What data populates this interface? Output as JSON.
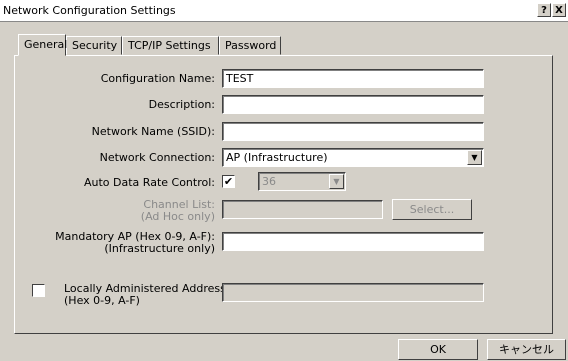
{
  "window": {
    "title": "Network Configuration Settings",
    "help_glyph": "?",
    "close_glyph": "X"
  },
  "tabs": [
    {
      "label": "General",
      "active": true
    },
    {
      "label": "Security",
      "active": false
    },
    {
      "label": "TCP/IP Settings",
      "active": false
    },
    {
      "label": "Password",
      "active": false
    }
  ],
  "form": {
    "configuration_name": {
      "label": "Configuration Name:",
      "value": "TEST"
    },
    "description": {
      "label": "Description:",
      "value": ""
    },
    "network_name": {
      "label": "Network Name (SSID):",
      "value": ""
    },
    "network_connection": {
      "label": "Network Connection:",
      "value": "AP (Infrastructure)"
    },
    "auto_data_rate": {
      "label": "Auto Data Rate Control:",
      "checked": true,
      "check_glyph": "✔",
      "rate_value": "36"
    },
    "channel_list": {
      "label_line1": "Channel List:",
      "label_line2": "(Ad Hoc only)",
      "value": "",
      "select_label": "Select..."
    },
    "mandatory_ap": {
      "label_line1": "Mandatory AP (Hex 0-9, A-F):",
      "label_line2": "(Infrastructure only)",
      "value": ""
    },
    "locally_administered": {
      "label_line1": "Locally Administered Address:",
      "label_line2": "(Hex 0-9, A-F)",
      "checked": false,
      "value": ""
    }
  },
  "footer": {
    "ok_label": "OK",
    "cancel_label": "キャンセル"
  }
}
